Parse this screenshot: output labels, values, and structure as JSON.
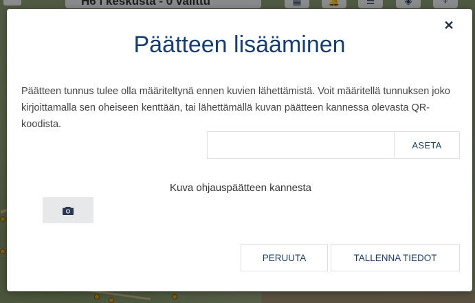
{
  "background": {
    "top_title": "H6 i keskusta - 0 valittu"
  },
  "modal": {
    "title": "Päätteen lisääminen",
    "description": "Päätteen tunnus tulee olla määriteltynä ennen kuvien lähettämistä. Voit määritellä tunnuksen joko kirjoittamalla sen oheiseen kenttään, tai lähettämällä kuvan päätteen kannessa olevasta QR-koodista.",
    "id_input": {
      "value": "",
      "placeholder": ""
    },
    "set_button_label": "ASETA",
    "photo_label": "Kuva ohjauspäätteen kannesta",
    "cancel_button_label": "PERUUTA",
    "save_button_label": "TALLENNA TIEDOT",
    "close_icon": "close-icon",
    "camera_icon": "camera-icon"
  },
  "colors": {
    "title": "#173d6e",
    "button_text": "#1e3c66",
    "overlay": "rgba(0,0,0,0.42)"
  }
}
